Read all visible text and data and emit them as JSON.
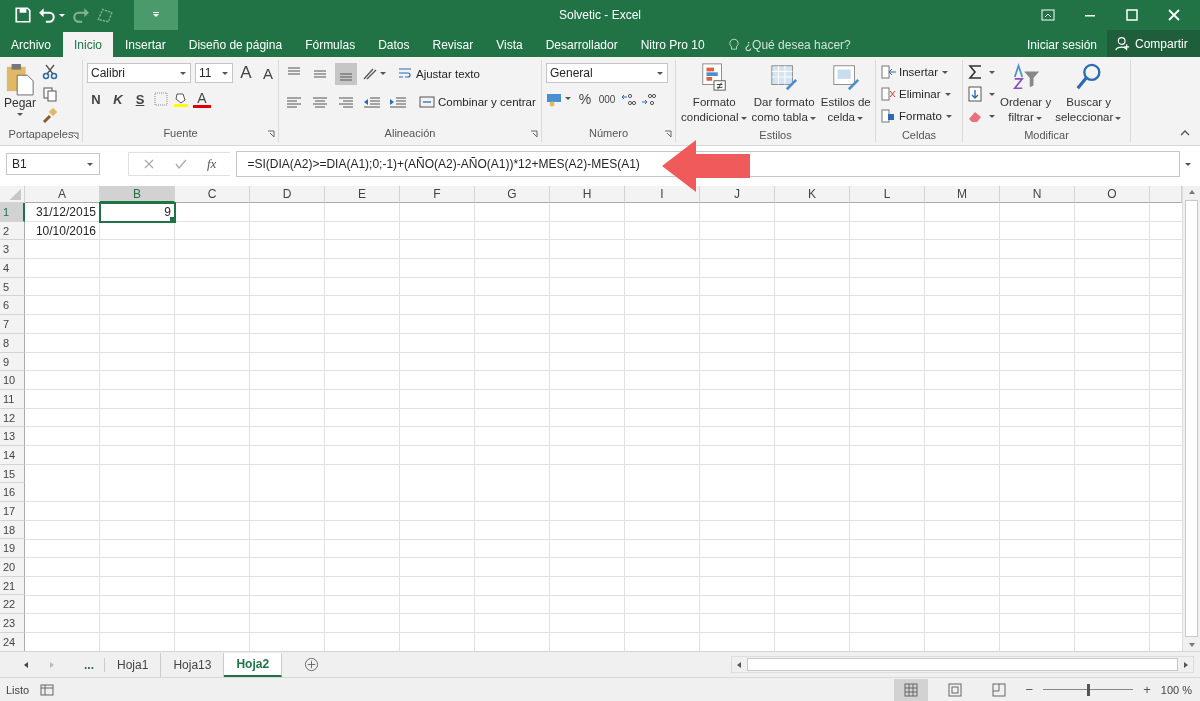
{
  "window": {
    "title": "Solvetic - Excel"
  },
  "ribbon_tabs": [
    {
      "label": "Archivo",
      "selected": false
    },
    {
      "label": "Inicio",
      "selected": true
    },
    {
      "label": "Insertar",
      "selected": false
    },
    {
      "label": "Diseño de página",
      "selected": false
    },
    {
      "label": "Fórmulas",
      "selected": false
    },
    {
      "label": "Datos",
      "selected": false
    },
    {
      "label": "Revisar",
      "selected": false
    },
    {
      "label": "Vista",
      "selected": false
    },
    {
      "label": "Desarrollador",
      "selected": false
    },
    {
      "label": "Nitro Pro 10",
      "selected": false
    }
  ],
  "tell_me": {
    "placeholder": "¿Qué desea hacer?"
  },
  "account": {
    "sign_in": "Iniciar sesión",
    "share": "Compartir"
  },
  "clipboard": {
    "label": "Portapapeles",
    "paste": "Pegar"
  },
  "font": {
    "label": "Fuente",
    "family": "Calibri",
    "size": "11",
    "grow": "A",
    "shrink": "A",
    "bold": "N",
    "italic": "K",
    "underline": "S",
    "font_color": "A"
  },
  "alignment": {
    "label": "Alineación",
    "wrap": "Ajustar texto",
    "merge": "Combinar y centrar",
    "vertical_buttons": [
      {
        "kind": "top",
        "selected": false
      },
      {
        "kind": "middle",
        "selected": false
      },
      {
        "kind": "bottom",
        "selected": true
      }
    ]
  },
  "number": {
    "label": "Número",
    "format": "General",
    "percent": "%",
    "thousands": "000"
  },
  "styles": {
    "label": "Estilos",
    "buttons": [
      {
        "kind": "conditional",
        "lines": [
          "Formato",
          "condicional"
        ]
      },
      {
        "kind": "table",
        "lines": [
          "Dar formato",
          "como tabla"
        ]
      },
      {
        "kind": "cell_styles",
        "lines": [
          "Estilos de",
          "celda"
        ]
      }
    ]
  },
  "cells": {
    "label": "Celdas",
    "buttons": [
      {
        "kind": "insert",
        "label": "Insertar"
      },
      {
        "kind": "delete",
        "label": "Eliminar"
      },
      {
        "kind": "format",
        "label": "Formato"
      }
    ]
  },
  "editing": {
    "label": "Modificar",
    "buttons": [
      {
        "kind": "sort",
        "lines": [
          "Ordenar y",
          "filtrar"
        ]
      },
      {
        "kind": "find",
        "lines": [
          "Buscar y",
          "seleccionar"
        ]
      }
    ]
  },
  "formula_bar": {
    "name_box": "B1",
    "function_label": "fx",
    "formula": "=SI(DIA(A2)>=DIA(A1);0;-1)+(AÑO(A2)-AÑO(A1))*12+MES(A2)-MES(A1)"
  },
  "annotation": {
    "kind": "arrow"
  },
  "sheet": {
    "columns": [
      {
        "label": "A",
        "selected": false
      },
      {
        "label": "B",
        "selected": true
      },
      {
        "label": "C",
        "selected": false
      },
      {
        "label": "D",
        "selected": false
      },
      {
        "label": "E",
        "selected": false
      },
      {
        "label": "F",
        "selected": false
      },
      {
        "label": "G",
        "selected": false
      },
      {
        "label": "H",
        "selected": false
      },
      {
        "label": "I",
        "selected": false
      },
      {
        "label": "J",
        "selected": false
      },
      {
        "label": "K",
        "selected": false
      },
      {
        "label": "L",
        "selected": false
      },
      {
        "label": "M",
        "selected": false
      },
      {
        "label": "N",
        "selected": false
      },
      {
        "label": "O",
        "selected": false
      }
    ],
    "rows": [
      {
        "header": "1",
        "selected": true,
        "cells": [
          {
            "text": "31/12/2015",
            "selected": false
          },
          {
            "text": "9",
            "selected": true
          }
        ]
      },
      {
        "header": "2",
        "selected": false,
        "cells": [
          {
            "text": "10/10/2016",
            "selected": false
          }
        ]
      },
      {
        "header": "3",
        "selected": false
      },
      {
        "header": "4",
        "selected": false
      },
      {
        "header": "5",
        "selected": false
      },
      {
        "header": "6",
        "selected": false
      },
      {
        "header": "7",
        "selected": false
      },
      {
        "header": "8",
        "selected": false
      },
      {
        "header": "9",
        "selected": false
      },
      {
        "header": "10",
        "selected": false
      },
      {
        "header": "11",
        "selected": false
      },
      {
        "header": "12",
        "selected": false
      },
      {
        "header": "13",
        "selected": false
      },
      {
        "header": "14",
        "selected": false
      },
      {
        "header": "15",
        "selected": false
      },
      {
        "header": "16",
        "selected": false
      },
      {
        "header": "17",
        "selected": false
      },
      {
        "header": "18",
        "selected": false
      },
      {
        "header": "19",
        "selected": false
      },
      {
        "header": "20",
        "selected": false
      },
      {
        "header": "21",
        "selected": false
      },
      {
        "header": "22",
        "selected": false
      },
      {
        "header": "23",
        "selected": false
      },
      {
        "header": "24",
        "selected": false
      }
    ]
  },
  "sheet_tabs": {
    "more": "...",
    "tabs": [
      {
        "label": "Hoja1",
        "selected": false
      },
      {
        "label": "Hoja13",
        "selected": false
      },
      {
        "label": "Hoja2",
        "selected": true
      }
    ]
  },
  "status_bar": {
    "status": "Listo",
    "views": [
      {
        "kind": "normal",
        "selected": true
      },
      {
        "kind": "page_layout",
        "selected": false
      },
      {
        "kind": "page_break",
        "selected": false
      }
    ],
    "zoom": {
      "out": "−",
      "in": "+",
      "level": 0.5,
      "reading": "100 %"
    }
  }
}
